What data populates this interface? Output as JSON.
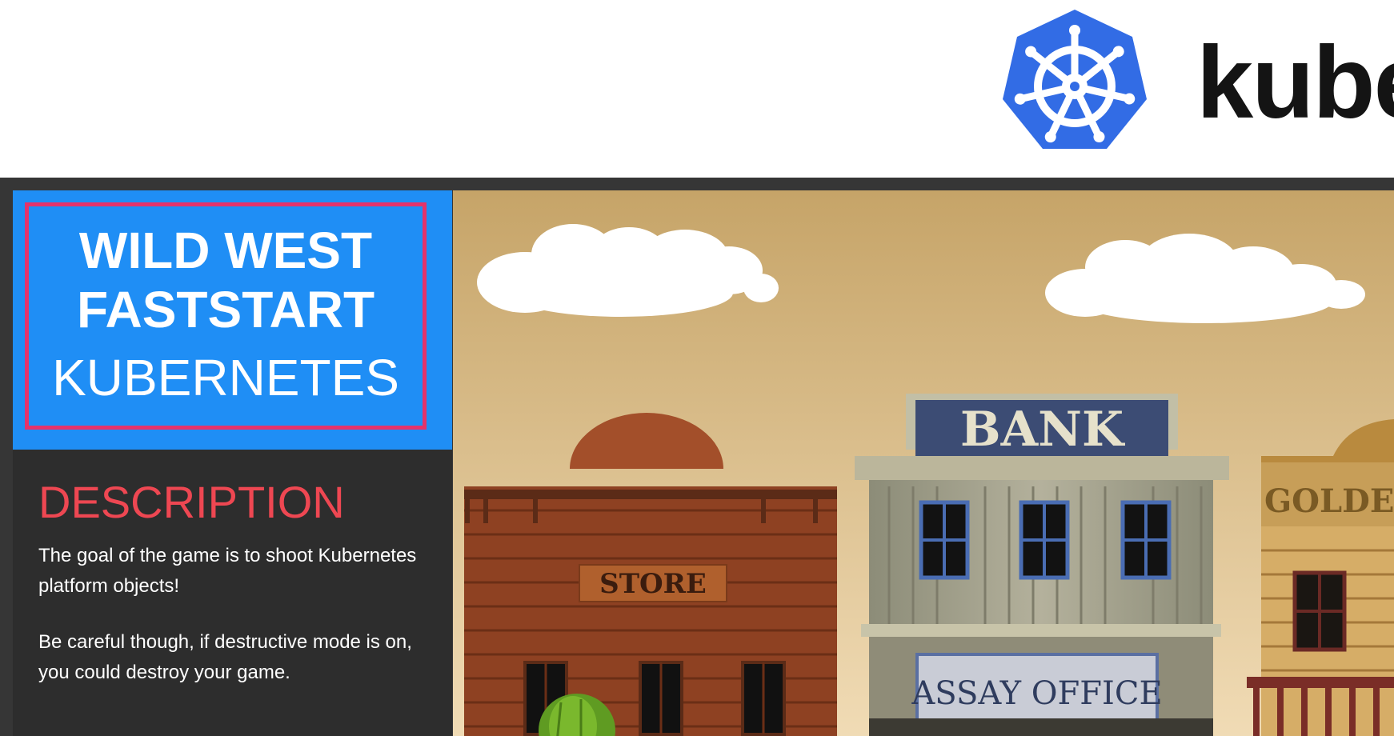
{
  "header": {
    "logo_text": "kube",
    "colors": {
      "logo_blue": "#326ce5",
      "logo_text": "#141414"
    }
  },
  "sidebar": {
    "title_line1": "WILD WEST",
    "title_line2": "FASTSTART",
    "title_line3": "KUBERNETES",
    "description_heading": "DESCRIPTION",
    "paragraph1": "The goal of the game is to shoot Kubernetes platform objects!",
    "paragraph2": "Be careful though, if destructive mode is on, you could destroy your game.",
    "colors": {
      "title_bg": "#1f8ef5",
      "title_border": "#e4336b",
      "heading": "#ee4752",
      "panel_bg": "#2d2d2d"
    }
  },
  "scene": {
    "signs": {
      "store": "STORE",
      "bank": "BANK",
      "assay": "ASSAY OFFICE",
      "golden": "GOLDEN"
    },
    "colors": {
      "sky_top": "#c6a468",
      "sky_bottom": "#f1dcb6"
    }
  }
}
